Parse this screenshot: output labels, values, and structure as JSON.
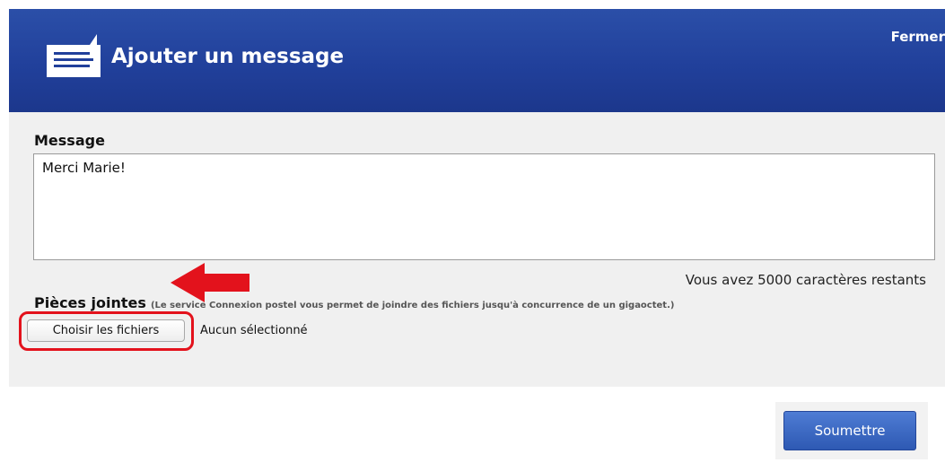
{
  "header": {
    "title": "Ajouter un message",
    "close_label": "Fermer",
    "icon": "message-icon",
    "background_color": "#21409b"
  },
  "message": {
    "label": "Message",
    "value": "Merci Marie!",
    "remaining_text": "Vous avez 5000 caractères restants"
  },
  "attachments": {
    "label": "Pièces jointes",
    "note": "(Le service Connexion postel vous permet de joindre des fichiers jusqu'à concurrence de un gigaoctet.)",
    "choose_button_label": "Choisir les fichiers",
    "status": "Aucun sélectionné"
  },
  "actions": {
    "submit_label": "Soumettre",
    "submit_color": "#3a67c4"
  },
  "annotations": {
    "color": "#e3121c",
    "arrow": "left-arrow",
    "box": "highlight-rectangle"
  }
}
